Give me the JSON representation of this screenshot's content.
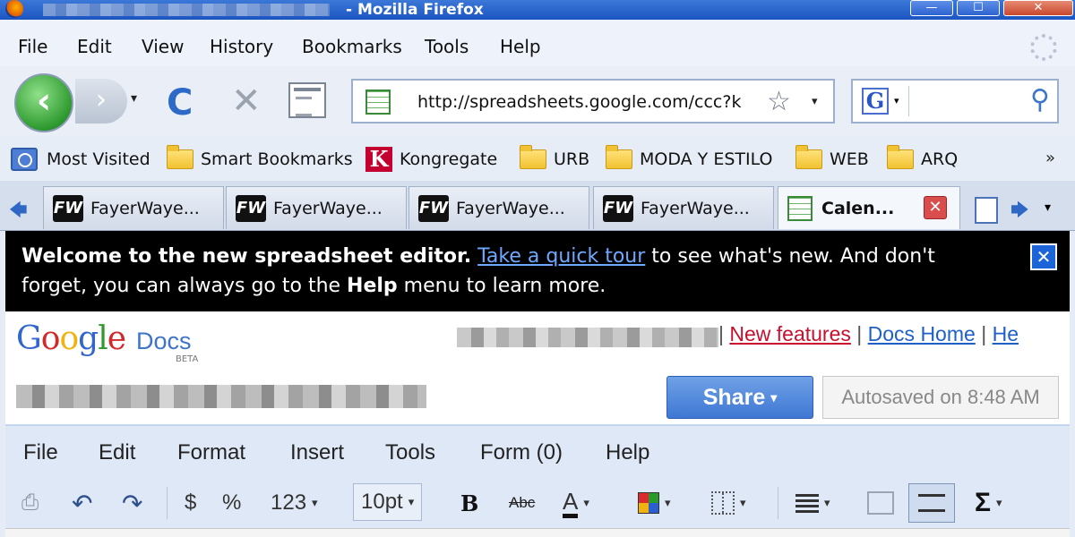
{
  "window": {
    "title_suffix": "- Mozilla Firefox",
    "minimize": "—",
    "maximize": "☐",
    "close": "✕"
  },
  "menu": {
    "items": [
      "File",
      "Edit",
      "View",
      "History",
      "Bookmarks",
      "Tools",
      "Help"
    ]
  },
  "nav": {
    "back": "‹",
    "forward": "›",
    "dropdown": "▾",
    "reload": "C",
    "stop": "✕",
    "url": "http://spreadsheets.google.com/ccc?k",
    "star": "☆",
    "search_engine_letter": "G",
    "search_glass": "⚲"
  },
  "bookmarks": {
    "items": [
      "Most Visited",
      "Smart Bookmarks",
      "Kongregate",
      "URB",
      "MODA Y ESTILO",
      "WEB",
      "ARQ"
    ],
    "kongregate_letter": "K",
    "more": "»"
  },
  "tabs": {
    "items": [
      {
        "label": "FayerWaye..."
      },
      {
        "label": "FayerWaye..."
      },
      {
        "label": "FayerWaye..."
      },
      {
        "label": "FayerWaye..."
      },
      {
        "label": "Calen..."
      }
    ],
    "fw_icon_text": "FW",
    "close": "✕",
    "scroll_left": "🡄",
    "scroll_right": "🡆",
    "list": "▾"
  },
  "banner": {
    "bold_intro": "Welcome to the new spreadsheet editor.",
    "link": "Take a quick tour",
    "rest1": " to see what's new. And don't",
    "rest2": "forget, you can always go to the ",
    "help_word": "Help",
    "rest3": " menu to learn more.",
    "close": "✕"
  },
  "docs": {
    "logo_letters": [
      "G",
      "o",
      "o",
      "g",
      "l",
      "e"
    ],
    "logo_docs": "Docs",
    "logo_beta": "BETA",
    "link_sep": "|",
    "new_features": "New features",
    "docs_home": "Docs Home",
    "he": "He",
    "share": "Share",
    "share_caret": "▾",
    "autosave": "Autosaved on 8:48 AM"
  },
  "sheet_menu": {
    "items": [
      "File",
      "Edit",
      "Format",
      "Insert",
      "Tools",
      "Form (0)",
      "Help"
    ]
  },
  "toolbar": {
    "dollar": "$",
    "percent": "%",
    "number_format": "123",
    "font_size": "10pt",
    "bold": "B",
    "strike": "Abc",
    "text_color": "A",
    "sigma": "Σ",
    "drop": "▾",
    "undo": "↶",
    "redo": "↷",
    "print": "⎙"
  },
  "colors": {
    "accent": "#3f78d4",
    "new_features": "#c8102e",
    "link": "#1f5fc8"
  }
}
